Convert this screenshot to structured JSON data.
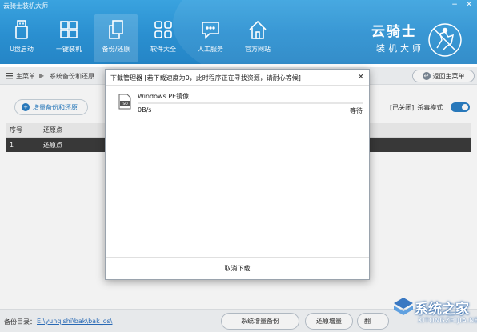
{
  "app": {
    "title": "云骑士装机大师",
    "minimize": "−",
    "close": "✕"
  },
  "nav": [
    {
      "label": "U盘启动",
      "icon": "usb-icon"
    },
    {
      "label": "一键装机",
      "icon": "windows-icon"
    },
    {
      "label": "备份/还原",
      "icon": "copy-icon"
    },
    {
      "label": "软件大全",
      "icon": "apps-grid-icon"
    },
    {
      "label": "人工服务",
      "icon": "chat-icon"
    },
    {
      "label": "官方网站",
      "icon": "home-icon"
    }
  ],
  "nav_active_index": 2,
  "brand": {
    "name": "云骑士",
    "sub": "装机大师"
  },
  "breadcrumb": {
    "home": "主菜单",
    "sep": "▶",
    "current": "系统备份和还原"
  },
  "back_button": {
    "label": "返回主菜单",
    "arrow": "↩"
  },
  "main": {
    "tab_label": "增量备份和还原",
    "tab_icon": "+",
    "option_status": "[已关闭]",
    "option_label": "杀毒模式",
    "table": {
      "headers": [
        "序号",
        "还原点"
      ],
      "rows": [
        {
          "index": "1",
          "name": "还原点"
        }
      ]
    }
  },
  "footer": {
    "backup_dir_label": "备份目录：",
    "backup_dir_path": "E:\\yunqishi\\bak\\bak_os\\",
    "btn_incremental": "系统增量备份",
    "btn_restore": "还原增量",
    "btn_third": "翻"
  },
  "modal": {
    "title": "下载管理器 [若下载速度为0，此时程序正在寻找资源，请耐心等候]",
    "close": "✕",
    "item": {
      "name": "Windows PE镜像",
      "speed": "0B/s",
      "status": "等待",
      "progress": 0.0,
      "icon_text": "ISO"
    },
    "cancel_label": "取消下载"
  },
  "watermark": {
    "text": "系统之家",
    "url": "XITONGZHIJIA.NET"
  },
  "colors": {
    "header": "#2a8fd0",
    "accent": "#2b7fc4",
    "selected_row": "#3c3c3c"
  }
}
